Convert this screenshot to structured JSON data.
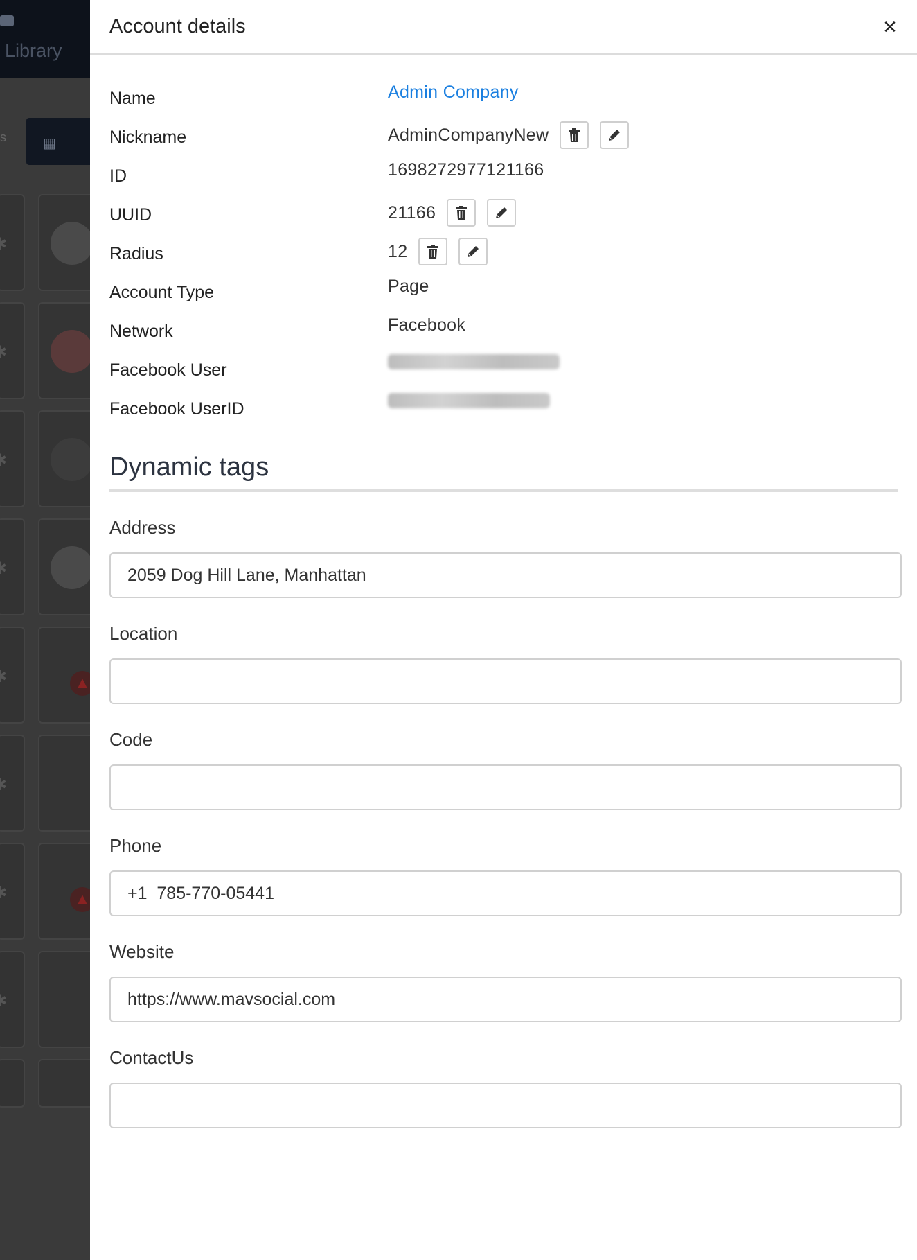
{
  "background": {
    "library_label": "Library"
  },
  "panel": {
    "title": "Account details",
    "close_icon": "close-icon"
  },
  "details": {
    "name_label": "Name",
    "name_value": "Admin Company",
    "nickname_label": "Nickname",
    "nickname_value": "AdminCompanyNew",
    "id_label": "ID",
    "id_value": "1698272977121166",
    "uuid_label": "UUID",
    "uuid_value": "21166",
    "radius_label": "Radius",
    "radius_value": "12",
    "account_type_label": "Account Type",
    "account_type_value": "Page",
    "network_label": "Network",
    "network_value": "Facebook",
    "facebook_user_label": "Facebook User",
    "facebook_userid_label": "Facebook UserID"
  },
  "dynamic_tags": {
    "title": "Dynamic tags",
    "fields": {
      "address": {
        "label": "Address",
        "value": "2059 Dog Hill Lane, Manhattan"
      },
      "location": {
        "label": "Location",
        "value": ""
      },
      "code": {
        "label": "Code",
        "value": ""
      },
      "phone": {
        "label": "Phone",
        "value": "+1  785-770-05441"
      },
      "website": {
        "label": "Website",
        "value": "https://www.mavsocial.com"
      },
      "contactus": {
        "label": "ContactUs",
        "value": ""
      }
    }
  },
  "colors": {
    "link": "#1a7fe0",
    "panel_bg": "#ffffff",
    "overlay_bg": "#2b2b2b"
  }
}
